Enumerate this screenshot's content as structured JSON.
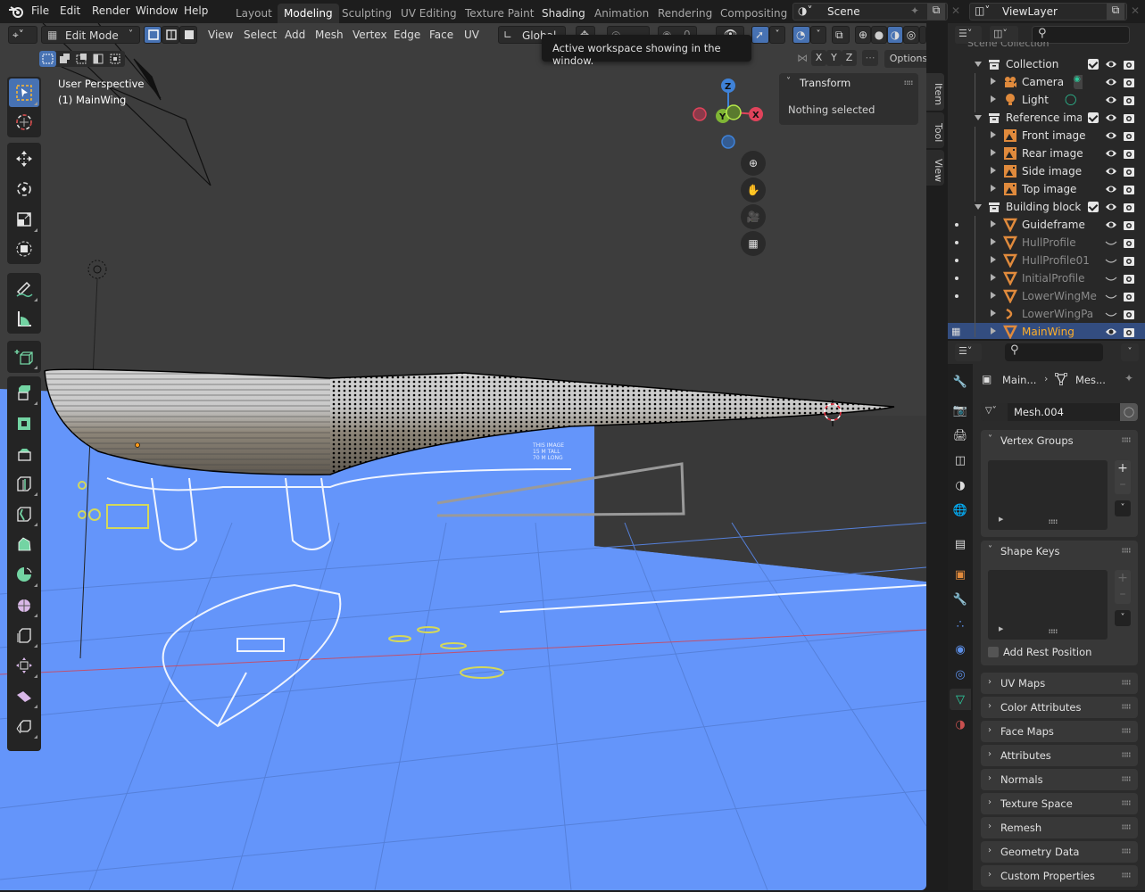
{
  "topbar": {
    "menus": [
      "File",
      "Edit",
      "Render",
      "Window",
      "Help"
    ],
    "workspaces": [
      "Layout",
      "Modeling",
      "Sculpting",
      "UV Editing",
      "Texture Paint",
      "Shading",
      "Animation",
      "Rendering",
      "Compositing"
    ],
    "active_workspace": "Modeling",
    "scene_name": "Scene",
    "view_layer_name": "ViewLayer"
  },
  "tooltip": {
    "text": "Active workspace showing in the window."
  },
  "viewport": {
    "mode": "Edit Mode",
    "menus": [
      "View",
      "Select",
      "Add",
      "Mesh",
      "Vertex",
      "Edge",
      "Face",
      "UV"
    ],
    "transform_orientation": "Global",
    "proportional_value": "0",
    "mirror_axes": [
      "X",
      "Y",
      "Z"
    ],
    "options_label": "Options",
    "overlay_title": "User Perspective",
    "overlay_object": "(1) MainWing",
    "gizmo_axes": {
      "z": "Z",
      "y": "Y",
      "x": "X"
    },
    "colors": {
      "floor": "#6495fa",
      "background": "#3d3d3d",
      "accent": "#4772b3",
      "axis_x": "#e0435b",
      "axis_y": "#7fb535",
      "axis_z": "#3f82d8"
    },
    "reference_text": [
      "THIS IMAGE",
      "15 M TALL",
      "70 M LONG"
    ]
  },
  "n_panel": {
    "section_title": "Transform",
    "empty_text": "Nothing selected",
    "tabs": [
      "Item",
      "Tool",
      "View"
    ]
  },
  "outliner": {
    "search_placeholder": "",
    "header_partial": "Scene Collection",
    "rows": [
      {
        "label": "Collection",
        "type": "collection",
        "depth": 1,
        "expanded": true,
        "checkbox": true,
        "visible": true
      },
      {
        "label": "Camera",
        "type": "camera",
        "depth": 2,
        "visible": true
      },
      {
        "label": "Light",
        "type": "light",
        "depth": 2,
        "visible": true
      },
      {
        "label": "Reference images",
        "type": "collection",
        "depth": 1,
        "expanded": true,
        "checkbox": true,
        "visible": true
      },
      {
        "label": "Front image",
        "type": "image",
        "depth": 2,
        "visible": true
      },
      {
        "label": "Rear image",
        "type": "image",
        "depth": 2,
        "visible": true
      },
      {
        "label": "Side image",
        "type": "image",
        "depth": 2,
        "visible": true
      },
      {
        "label": "Top image",
        "type": "image",
        "depth": 2,
        "visible": true
      },
      {
        "label": "Building blocks",
        "type": "collection",
        "depth": 1,
        "expanded": true,
        "checkbox": true,
        "visible": true
      },
      {
        "label": "Guideframe",
        "type": "mesh",
        "depth": 2,
        "visible": true,
        "dot": true
      },
      {
        "label": "HullProfile",
        "type": "mesh",
        "depth": 2,
        "visible": false,
        "dot": true
      },
      {
        "label": "HullProfile01",
        "type": "mesh",
        "depth": 2,
        "visible": false,
        "dot": true
      },
      {
        "label": "InitialProfile",
        "type": "mesh",
        "depth": 2,
        "visible": false,
        "dot": true
      },
      {
        "label": "LowerWingMe",
        "type": "mesh",
        "depth": 2,
        "visible": false,
        "dot": true
      },
      {
        "label": "LowerWingPa",
        "type": "curve",
        "depth": 2,
        "visible": false
      },
      {
        "label": "MainWing",
        "type": "mesh",
        "depth": 2,
        "visible": true,
        "selected": true
      }
    ]
  },
  "properties": {
    "breadcrumb": {
      "object": "Main...",
      "data": "Mes..."
    },
    "mesh_name": "Mesh.004",
    "vertex_groups_title": "Vertex Groups",
    "shape_keys_title": "Shape Keys",
    "add_rest_position_label": "Add Rest Position",
    "add_rest_position_checked": false,
    "collapsed_panels": [
      "UV Maps",
      "Color Attributes",
      "Face Maps",
      "Attributes",
      "Normals",
      "Texture Space",
      "Remesh",
      "Geometry Data",
      "Custom Properties"
    ],
    "tabs": [
      "tool",
      "render",
      "output",
      "view-layer",
      "scene",
      "world",
      "collection",
      "object",
      "modifiers",
      "particles",
      "physics",
      "constraints",
      "data",
      "material"
    ],
    "active_tab": "data"
  }
}
